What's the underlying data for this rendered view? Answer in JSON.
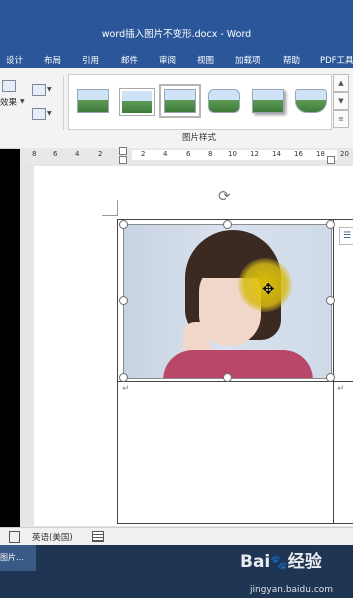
{
  "window": {
    "title": "word插入图片不变形.docx  -  Word"
  },
  "ribbon_tabs": [
    "设计",
    "布局",
    "引用",
    "邮件",
    "审阅",
    "视图",
    "加载项",
    "帮助",
    "PDF工具"
  ],
  "ribbon": {
    "left_group_label": "效果",
    "picture_styles_label": "图片样式",
    "style_thumbnail_count": 6
  },
  "ruler": {
    "ticks": [
      "8",
      "6",
      "4",
      "2",
      "2",
      "4",
      "6",
      "8",
      "10",
      "12",
      "14",
      "16",
      "18",
      "20"
    ]
  },
  "document": {
    "paragraph_mark": "↵"
  },
  "status_bar": {
    "language": "英语(美国)"
  },
  "taskbar": {
    "active_item": "图片..."
  },
  "watermark": {
    "brand": "Bai",
    "brand_suffix": "经验",
    "url": "jingyan.baidu.com"
  },
  "colors": {
    "title_bar": "#2b579a",
    "ribbon_bg": "#f3f3f3",
    "highlight": "#e6c800"
  }
}
